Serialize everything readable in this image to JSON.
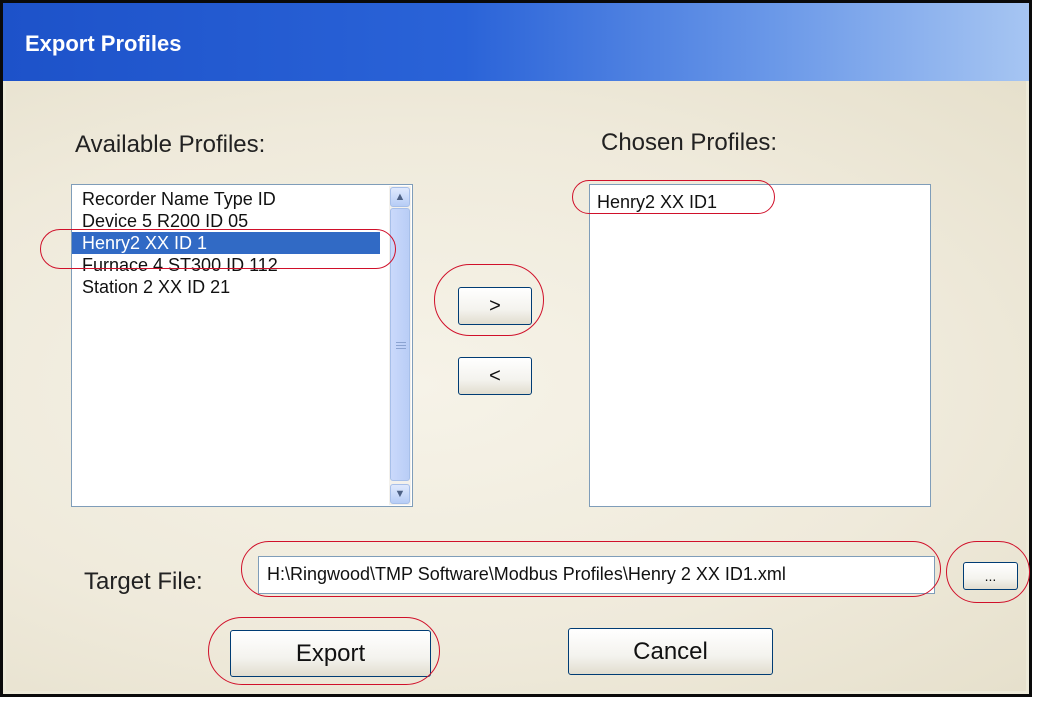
{
  "window": {
    "title": "Export Profiles"
  },
  "available": {
    "label": "Available Profiles:",
    "items": [
      {
        "label": "Recorder Name  Type  ID",
        "selected": false
      },
      {
        "label": "Device 5  R200  ID 05",
        "selected": false
      },
      {
        "label": "Henry2  XX  ID 1",
        "selected": true
      },
      {
        "label": "Furnace 4  ST300  ID 112",
        "selected": false
      },
      {
        "label": "Station 2  XX  ID 21",
        "selected": false
      }
    ]
  },
  "chosen": {
    "label": "Chosen Profiles:",
    "items": [
      {
        "label": "Henry2  XX  ID1"
      }
    ]
  },
  "buttons": {
    "add_label": ">",
    "remove_label": "<",
    "browse_label": "...",
    "export_label": "Export",
    "cancel_label": "Cancel"
  },
  "target": {
    "label": "Target File:",
    "value": "H:\\Ringwood\\TMP Software\\Modbus Profiles\\Henry 2 XX ID1.xml"
  },
  "annotations": {
    "color": "#d0102a"
  }
}
